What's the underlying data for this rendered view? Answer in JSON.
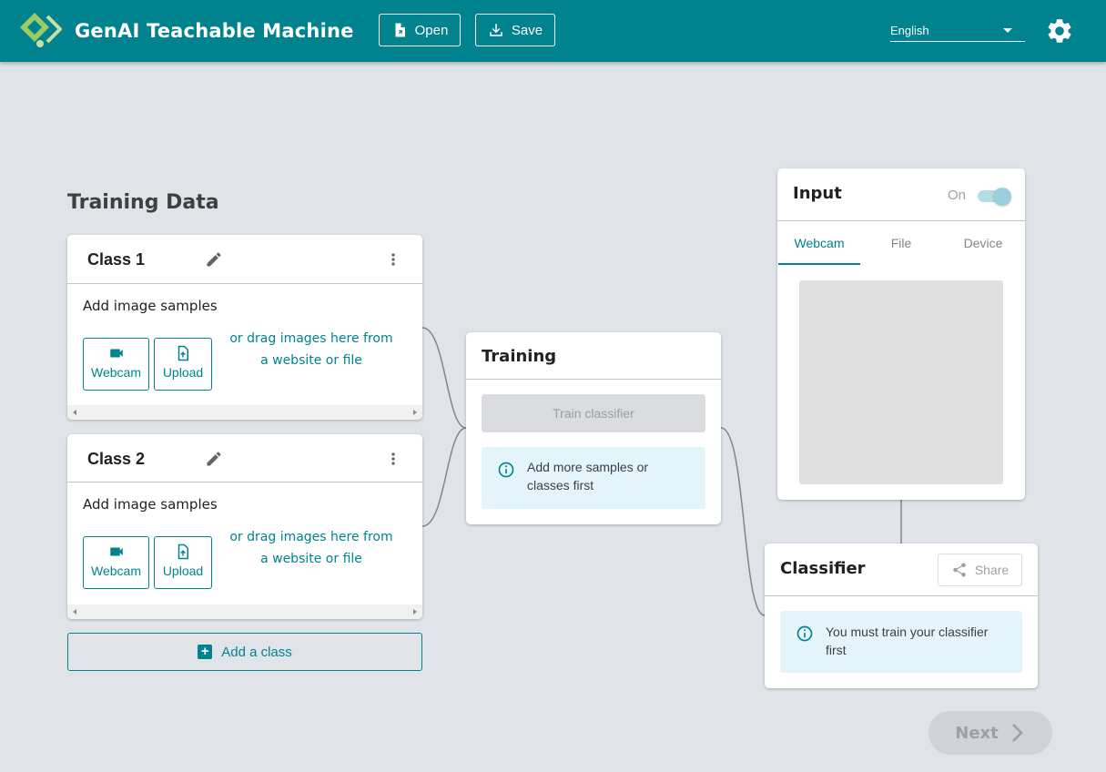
{
  "header": {
    "title": "GenAI Teachable Machine",
    "open_label": "Open",
    "save_label": "Save",
    "language": "English"
  },
  "training_data": {
    "title": "Training Data",
    "classes": [
      {
        "name": "Class 1",
        "add_samples": "Add image samples",
        "webcam": "Webcam",
        "upload": "Upload",
        "drag_hint": "or drag images here from a website or file"
      },
      {
        "name": "Class 2",
        "add_samples": "Add image samples",
        "webcam": "Webcam",
        "upload": "Upload",
        "drag_hint": "or drag images here from a website or file"
      }
    ],
    "add_class_label": "Add a class"
  },
  "training": {
    "title": "Training",
    "train_button": "Train classifier",
    "info": "Add more samples or classes first"
  },
  "input": {
    "title": "Input",
    "toggle_label": "On",
    "toggle_on": true,
    "tabs": [
      "Webcam",
      "File",
      "Device"
    ],
    "active_tab": "Webcam"
  },
  "classifier": {
    "title": "Classifier",
    "share_label": "Share",
    "info": "You must train your classifier first"
  },
  "next_label": "Next",
  "colors": {
    "header": "#00838f",
    "accent": "#00838f",
    "background": "#e0e4e8",
    "info_bg": "#e3f4fb",
    "logo_green": "#9ccc65"
  }
}
